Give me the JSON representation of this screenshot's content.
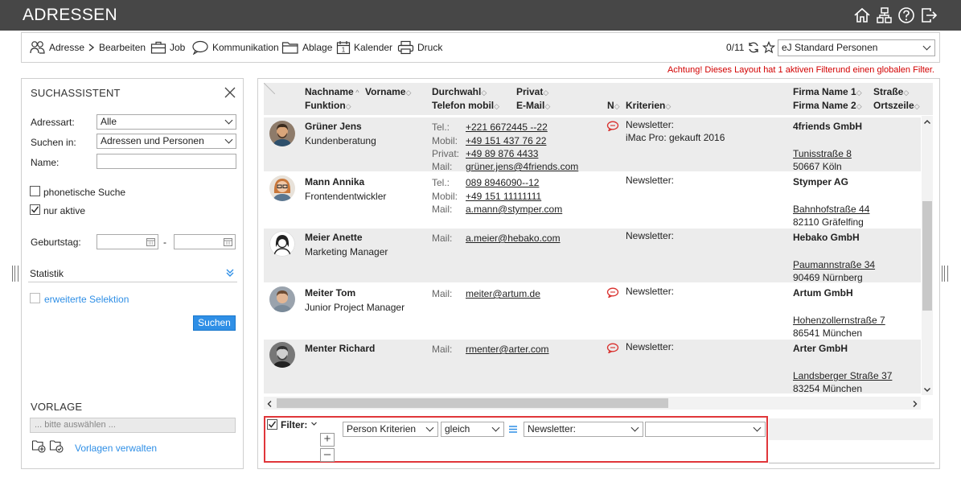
{
  "app": {
    "title": "ADRESSEN"
  },
  "titlebar": {
    "icons": [
      "home-icon",
      "sitemap-icon",
      "help-icon",
      "logout-icon"
    ]
  },
  "toolbar": {
    "items": [
      {
        "label": "Adresse",
        "icon": "contacts-icon"
      },
      {
        "label": "Bearbeiten",
        "icon": "chevron-right-icon"
      },
      {
        "label": "Job",
        "icon": "briefcase-icon"
      },
      {
        "label": "Kommunikation",
        "icon": "speech-bubble-icon"
      },
      {
        "label": "Ablage",
        "icon": "folder-icon"
      },
      {
        "label": "Kalender",
        "icon": "calendar-icon"
      },
      {
        "label": "Druck",
        "icon": "printer-icon"
      }
    ],
    "counter": "0/11",
    "layout_value": "eJ Standard Personen",
    "warning": "Achtung! Dieses Layout hat 1 aktiven Filterund einen globalen Filter."
  },
  "search": {
    "title": "SUCHASSISTENT",
    "adressart_label": "Adressart:",
    "adressart_value": "Alle",
    "suchen_label": "Suchen in:",
    "suchen_value": "Adressen und Personen",
    "name_label": "Name:",
    "name_value": "",
    "phonetic_label": "phonetische Suche",
    "phonetic_checked": false,
    "active_label": "nur aktive",
    "active_checked": true,
    "birthday_label": "Geburtstag:",
    "birthday_sep": "-",
    "statistik_label": "Statistik",
    "extended_label": "erweiterte Selektion",
    "search_button": "Suchen"
  },
  "template": {
    "title": "VORLAGE",
    "placeholder": "... bitte auswählen ...",
    "manage_label": "Vorlagen verwalten"
  },
  "grid": {
    "headers": {
      "nachname": "Nachname",
      "vorname": "Vorname",
      "funktion": "Funktion",
      "durchwahl": "Durchwahl",
      "telefon_mobil": "Telefon mobil",
      "privat": "Privat",
      "email": "E-Mail",
      "n": "N",
      "kriterien": "Kriterien",
      "firma1": "Firma Name 1",
      "firma2": "Firma Name 2",
      "strasse": "Straße",
      "ortszeile": "Ortszeile"
    },
    "rows": [
      {
        "name": "Grüner Jens",
        "function": "Kundenberatung",
        "contacts": [
          {
            "type": "Tel.:",
            "value": "+221 6672445 --22"
          },
          {
            "type": "Mobil:",
            "value": "+49 151 437 76 22"
          },
          {
            "type": "Privat:",
            "value": "+49 89 876 4433"
          },
          {
            "type": "Mail:",
            "value": "grüner.jens@4friends.com"
          }
        ],
        "has_note": true,
        "criteria": [
          "Newsletter:",
          "iMac Pro: gekauft 2016"
        ],
        "company": "4friends GmbH",
        "street": "Tunisstraße 8",
        "city": "50667 Köln",
        "avatar": "male-bearded"
      },
      {
        "name": "Mann Annika",
        "function": "Frontendentwickler",
        "contacts": [
          {
            "type": "Tel.:",
            "value": "089 8946090--12"
          },
          {
            "type": "Mobil:",
            "value": "+49 151 11111111"
          },
          {
            "type": "Mail:",
            "value": "a.mann@stymper.com"
          }
        ],
        "has_note": false,
        "criteria": [
          "Newsletter:"
        ],
        "company": "Stymper AG",
        "street": "Bahnhofstraße 44",
        "city": "82110 Gräfelfing",
        "avatar": "female-glasses"
      },
      {
        "name": "Meier Anette",
        "function": "Marketing Manager",
        "contacts": [
          {
            "type": "Mail:",
            "value": "a.meier@hebako.com"
          }
        ],
        "has_note": false,
        "criteria": [
          "Newsletter:"
        ],
        "company": "Hebako GmbH",
        "street": "Paumannstraße 34",
        "city": "90469 Nürnberg",
        "avatar": "placeholder-female"
      },
      {
        "name": "Meiter Tom",
        "function": "Junior Project Manager",
        "contacts": [
          {
            "type": "Mail:",
            "value": "meiter@artum.de"
          }
        ],
        "has_note": true,
        "criteria": [
          "Newsletter:"
        ],
        "company": "Artum GmbH",
        "street": "Hohenzollernstraße 7",
        "city": "86541 München",
        "avatar": "male-young"
      },
      {
        "name": "Menter Richard",
        "function": "",
        "contacts": [
          {
            "type": "Mail:",
            "value": "rmenter@arter.com"
          }
        ],
        "has_note": true,
        "criteria": [
          "Newsletter:"
        ],
        "company": "Arter GmbH",
        "street": "Landsberger Straße 37",
        "city": "83254 München",
        "avatar": "male-beard-bw"
      }
    ]
  },
  "filter": {
    "label": "Filter:",
    "checked": true,
    "field": "Person Kriterien",
    "operator": "gleich",
    "value": "Newsletter:",
    "extra": ""
  },
  "colors": {
    "titlebar": "#474747",
    "accent": "#2f8fe6",
    "warning": "#d20000",
    "filter_border": "#e0363a",
    "note": "#d9302d"
  }
}
